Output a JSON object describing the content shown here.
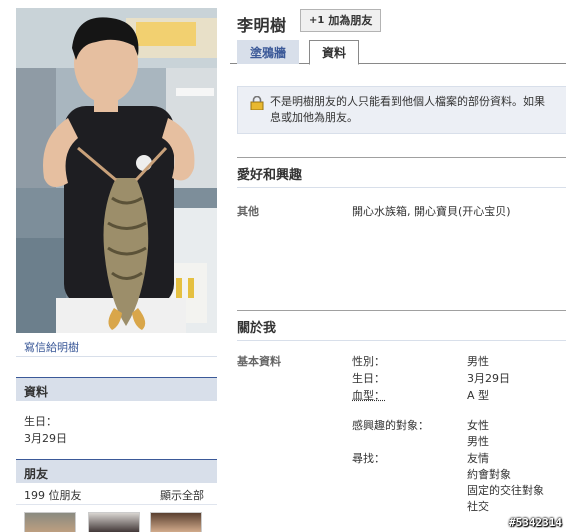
{
  "profile": {
    "name": "李明樹",
    "add_friend_label": "加為朋友",
    "add_friend_icon": "+1"
  },
  "tabs": [
    {
      "label": "塗鴉牆",
      "active": false
    },
    {
      "label": "資料",
      "active": true
    }
  ],
  "notice": {
    "icon": "lock-icon",
    "text_line1": "不是明樹朋友的人只能看到他個人檔案的部份資料。如果",
    "text_line2": "息或加他為朋友。"
  },
  "left": {
    "write_message_link": "寫信給明樹",
    "info_box": {
      "title": "資料",
      "birthday_label": "生日：",
      "birthday_value": "3月29日"
    },
    "friends_box": {
      "title": "朋友",
      "count_text": "199 位朋友",
      "show_all": "顯示全部"
    }
  },
  "hobbies": {
    "title": "愛好和興趣",
    "other_label": "其他",
    "other_value": "開心水族箱, 開心寶貝(开心宝贝)"
  },
  "about": {
    "title": "關於我",
    "basic_label": "基本資料",
    "sex_label": "性別：",
    "sex_value": "男性",
    "birthday_label": "生日：",
    "birthday_value": "3月29日",
    "blood_label": "血型：",
    "blood_value": "A 型",
    "interested_label": "感興趣的對象：",
    "interested_values": [
      "女性",
      "男性"
    ],
    "looking_label": "尋找：",
    "looking_values": [
      "友情",
      "約會對象",
      "固定的交往對象",
      "社交"
    ]
  },
  "watermark": "#5342314",
  "colors": {
    "link": "#3b5998",
    "tab_bg": "#d8dfea",
    "notice_bg": "#eceff5"
  }
}
